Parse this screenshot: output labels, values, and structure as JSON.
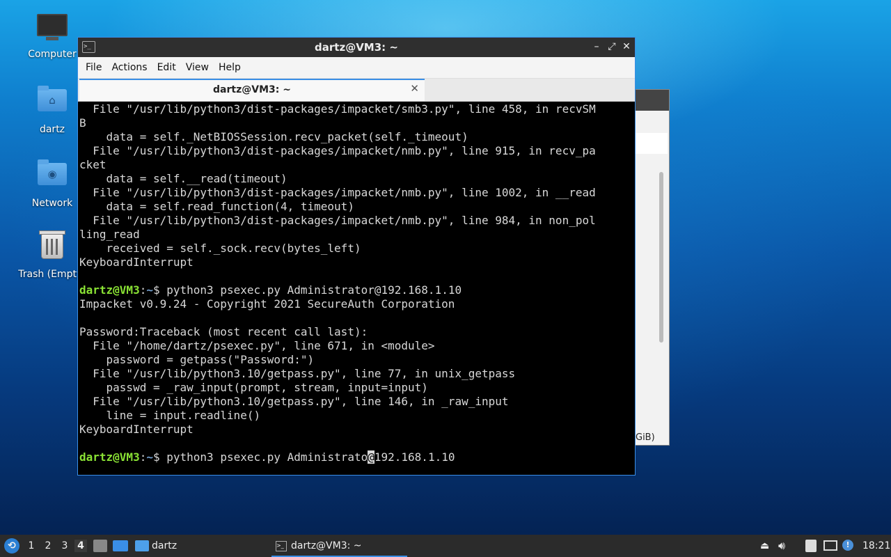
{
  "desktop": {
    "icons": [
      {
        "label": "Computer"
      },
      {
        "label": "dartz"
      },
      {
        "label": "Network"
      },
      {
        "label": "Trash (Empty)"
      }
    ]
  },
  "background_window": {
    "fragment": "GiB)"
  },
  "terminal_window": {
    "title": "dartz@VM3: ~",
    "menu": [
      "File",
      "Actions",
      "Edit",
      "View",
      "Help"
    ],
    "tab_label": "dartz@VM3: ~",
    "prompt": {
      "user": "dartz@VM3",
      "path": "~",
      "symbol": "$ "
    },
    "lines": [
      "  File \"/usr/lib/python3/dist-packages/impacket/smb3.py\", line 458, in recvSM",
      "B",
      "    data = self._NetBIOSSession.recv_packet(self._timeout)",
      "  File \"/usr/lib/python3/dist-packages/impacket/nmb.py\", line 915, in recv_pa",
      "cket",
      "    data = self.__read(timeout)",
      "  File \"/usr/lib/python3/dist-packages/impacket/nmb.py\", line 1002, in __read",
      "    data = self.read_function(4, timeout)",
      "  File \"/usr/lib/python3/dist-packages/impacket/nmb.py\", line 984, in non_pol",
      "ling_read",
      "    received = self._sock.recv(bytes_left)",
      "KeyboardInterrupt",
      "",
      "",
      "Impacket v0.9.24 - Copyright 2021 SecureAuth Corporation",
      "",
      "Password:Traceback (most recent call last):",
      "  File \"/home/dartz/psexec.py\", line 671, in <module>",
      "    password = getpass(\"Password:\")",
      "  File \"/usr/lib/python3.10/getpass.py\", line 77, in unix_getpass",
      "    passwd = _raw_input(prompt, stream, input=input)",
      "  File \"/usr/lib/python3.10/getpass.py\", line 146, in _raw_input",
      "    line = input.readline()",
      "KeyboardInterrupt",
      ""
    ],
    "command1": "python3 psexec.py Administrator@192.168.1.10",
    "command2_before_cursor": "python3 psexec.py Administrato",
    "command2_cursor_char": "@",
    "command2_after_cursor": "192.168.1.10"
  },
  "taskbar": {
    "workspaces": [
      "1",
      "2",
      "3",
      "4"
    ],
    "active_workspace": "4",
    "folder_label": "dartz",
    "task_label": "dartz@VM3: ~",
    "clock": "18:21"
  },
  "colors": {
    "accent": "#3a8ee6",
    "prompt_user": "#8ae234",
    "prompt_path": "#729fcf"
  }
}
